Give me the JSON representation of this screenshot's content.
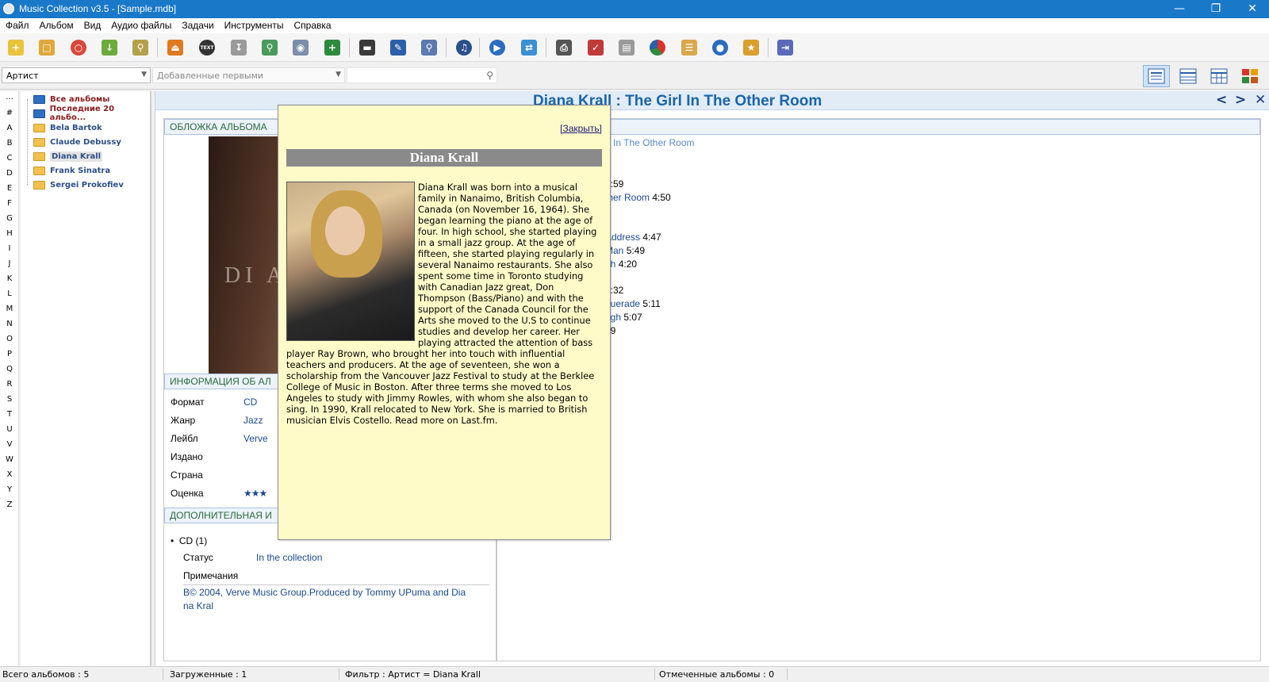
{
  "window": {
    "title": "Music Collection v3.5 - [Sample.mdb]"
  },
  "menu": [
    "Файл",
    "Альбом",
    "Вид",
    "Аудио файлы",
    "Задачи",
    "Инструменты",
    "Справка"
  ],
  "toolbar": {
    "icons": [
      "add-album-icon",
      "add-folder-icon",
      "lifebuoy-icon",
      "import-icon",
      "find-icon",
      "eject-icon",
      "text-disc-icon",
      "download-icon",
      "search-online-icon",
      "camera-icon",
      "new-window-icon",
      "window-icon",
      "edit-icon",
      "zoom-icon",
      "audio-search-icon",
      "play-icon",
      "shuffle-icon",
      "print-icon",
      "calendar-icon",
      "document-icon",
      "pie-chart-icon",
      "list-icon",
      "user-icon",
      "ribbon-icon",
      "exit-icon"
    ],
    "disc_label": "TEXT"
  },
  "filter": {
    "field": "Артист",
    "sort": "Добавленные первыми",
    "search_value": ""
  },
  "alphabet": [
    "...",
    "#",
    "A",
    "B",
    "C",
    "D",
    "E",
    "F",
    "G",
    "H",
    "I",
    "J",
    "K",
    "L",
    "M",
    "N",
    "O",
    "P",
    "Q",
    "R",
    "S",
    "T",
    "U",
    "V",
    "W",
    "X",
    "Y",
    "Z"
  ],
  "tree": {
    "items": [
      {
        "label": "Все альбомы"
      },
      {
        "label": "Последние 20 альбо..."
      },
      {
        "label": "Bela Bartok"
      },
      {
        "label": "Claude Debussy"
      },
      {
        "label": "Diana Krall"
      },
      {
        "label": "Frank Sinatra"
      },
      {
        "label": "Sergei Prokofiev"
      }
    ]
  },
  "album": {
    "title": "Diana Krall : The Girl In The Other Room",
    "nav_prev": "<",
    "nav_next": ">",
    "nav_close": "✕",
    "cover_header": "ОБЛОЖКА АЛЬБОМА",
    "cover_text": "DI A",
    "info_header": "ИНФОРМАЦИЯ ОБ АЛ",
    "info": [
      {
        "key": "Формат",
        "value": "CD"
      },
      {
        "key": "Жанр",
        "value": "Jazz"
      },
      {
        "key": "Лейбл",
        "value": "Verve"
      },
      {
        "key": "Издано",
        "value": ""
      },
      {
        "key": "Страна",
        "value": ""
      },
      {
        "key": "Оценка",
        "value": "★★★"
      }
    ],
    "extra_header": "ДОПОЛНИТЕЛЬНАЯ И",
    "media": "CD (1)",
    "status_key": "Статус",
    "status_value": "In the collection",
    "notes_key": "Примечания",
    "notes_value_1": "B© 2004, Verve Music Group.Produced by Tommy UPuma and Dia",
    "notes_value_2": "na Kral"
  },
  "tracklist": {
    "subtitle": "rl In The Other Room",
    "tracks": [
      {
        "name": "",
        "time": "3:59"
      },
      {
        "name": "ther Room",
        "time": "4:50"
      },
      {
        "name": "Address",
        "time": "4:47"
      },
      {
        "name": "Man",
        "time": "5:49"
      },
      {
        "name": "gh",
        "time": "4:20"
      },
      {
        "name": "",
        "time": "3:32"
      },
      {
        "name": "querade",
        "time": "5:11"
      },
      {
        "name": "ugh",
        "time": "5:07"
      },
      {
        "name": "",
        "time": "39"
      }
    ]
  },
  "popup": {
    "close": "[Закрыть]",
    "name": "Diana Krall",
    "bio": "Diana Krall was born into a musical family in Nanaimo, British Columbia, Canada (on November 16, 1964). She began learning the piano at the age of four. In high school, she started playing in a small jazz group. At the age of fifteen, she started playing regularly in several Nanaimo restaurants. She also spent some time in Toronto studying with Canadian Jazz great, Don Thompson (Bass/Piano) and with the support of the Canada Council for the Arts she moved to the U.S to continue studies and develop her career. Her playing attracted the attention of bass player Ray Brown, who brought her into touch with influential teachers and producers. At the age of seventeen, she won a scholarship from the Vancouver Jazz Festival to study at the Berklee College of Music in Boston. After three terms she moved to Los Angeles to study with Jimmy Rowles, with whom she also began to sing. In 1990, Krall relocated to New York. She is married to British musician Elvis Costello. Read more on Last.fm."
  },
  "status": {
    "total": "Всего альбомов : 5",
    "loaded": "Загруженные : 1",
    "filter": "Фильтр : Артист = Diana Krall",
    "marked": "Отмеченные альбомы : 0"
  }
}
